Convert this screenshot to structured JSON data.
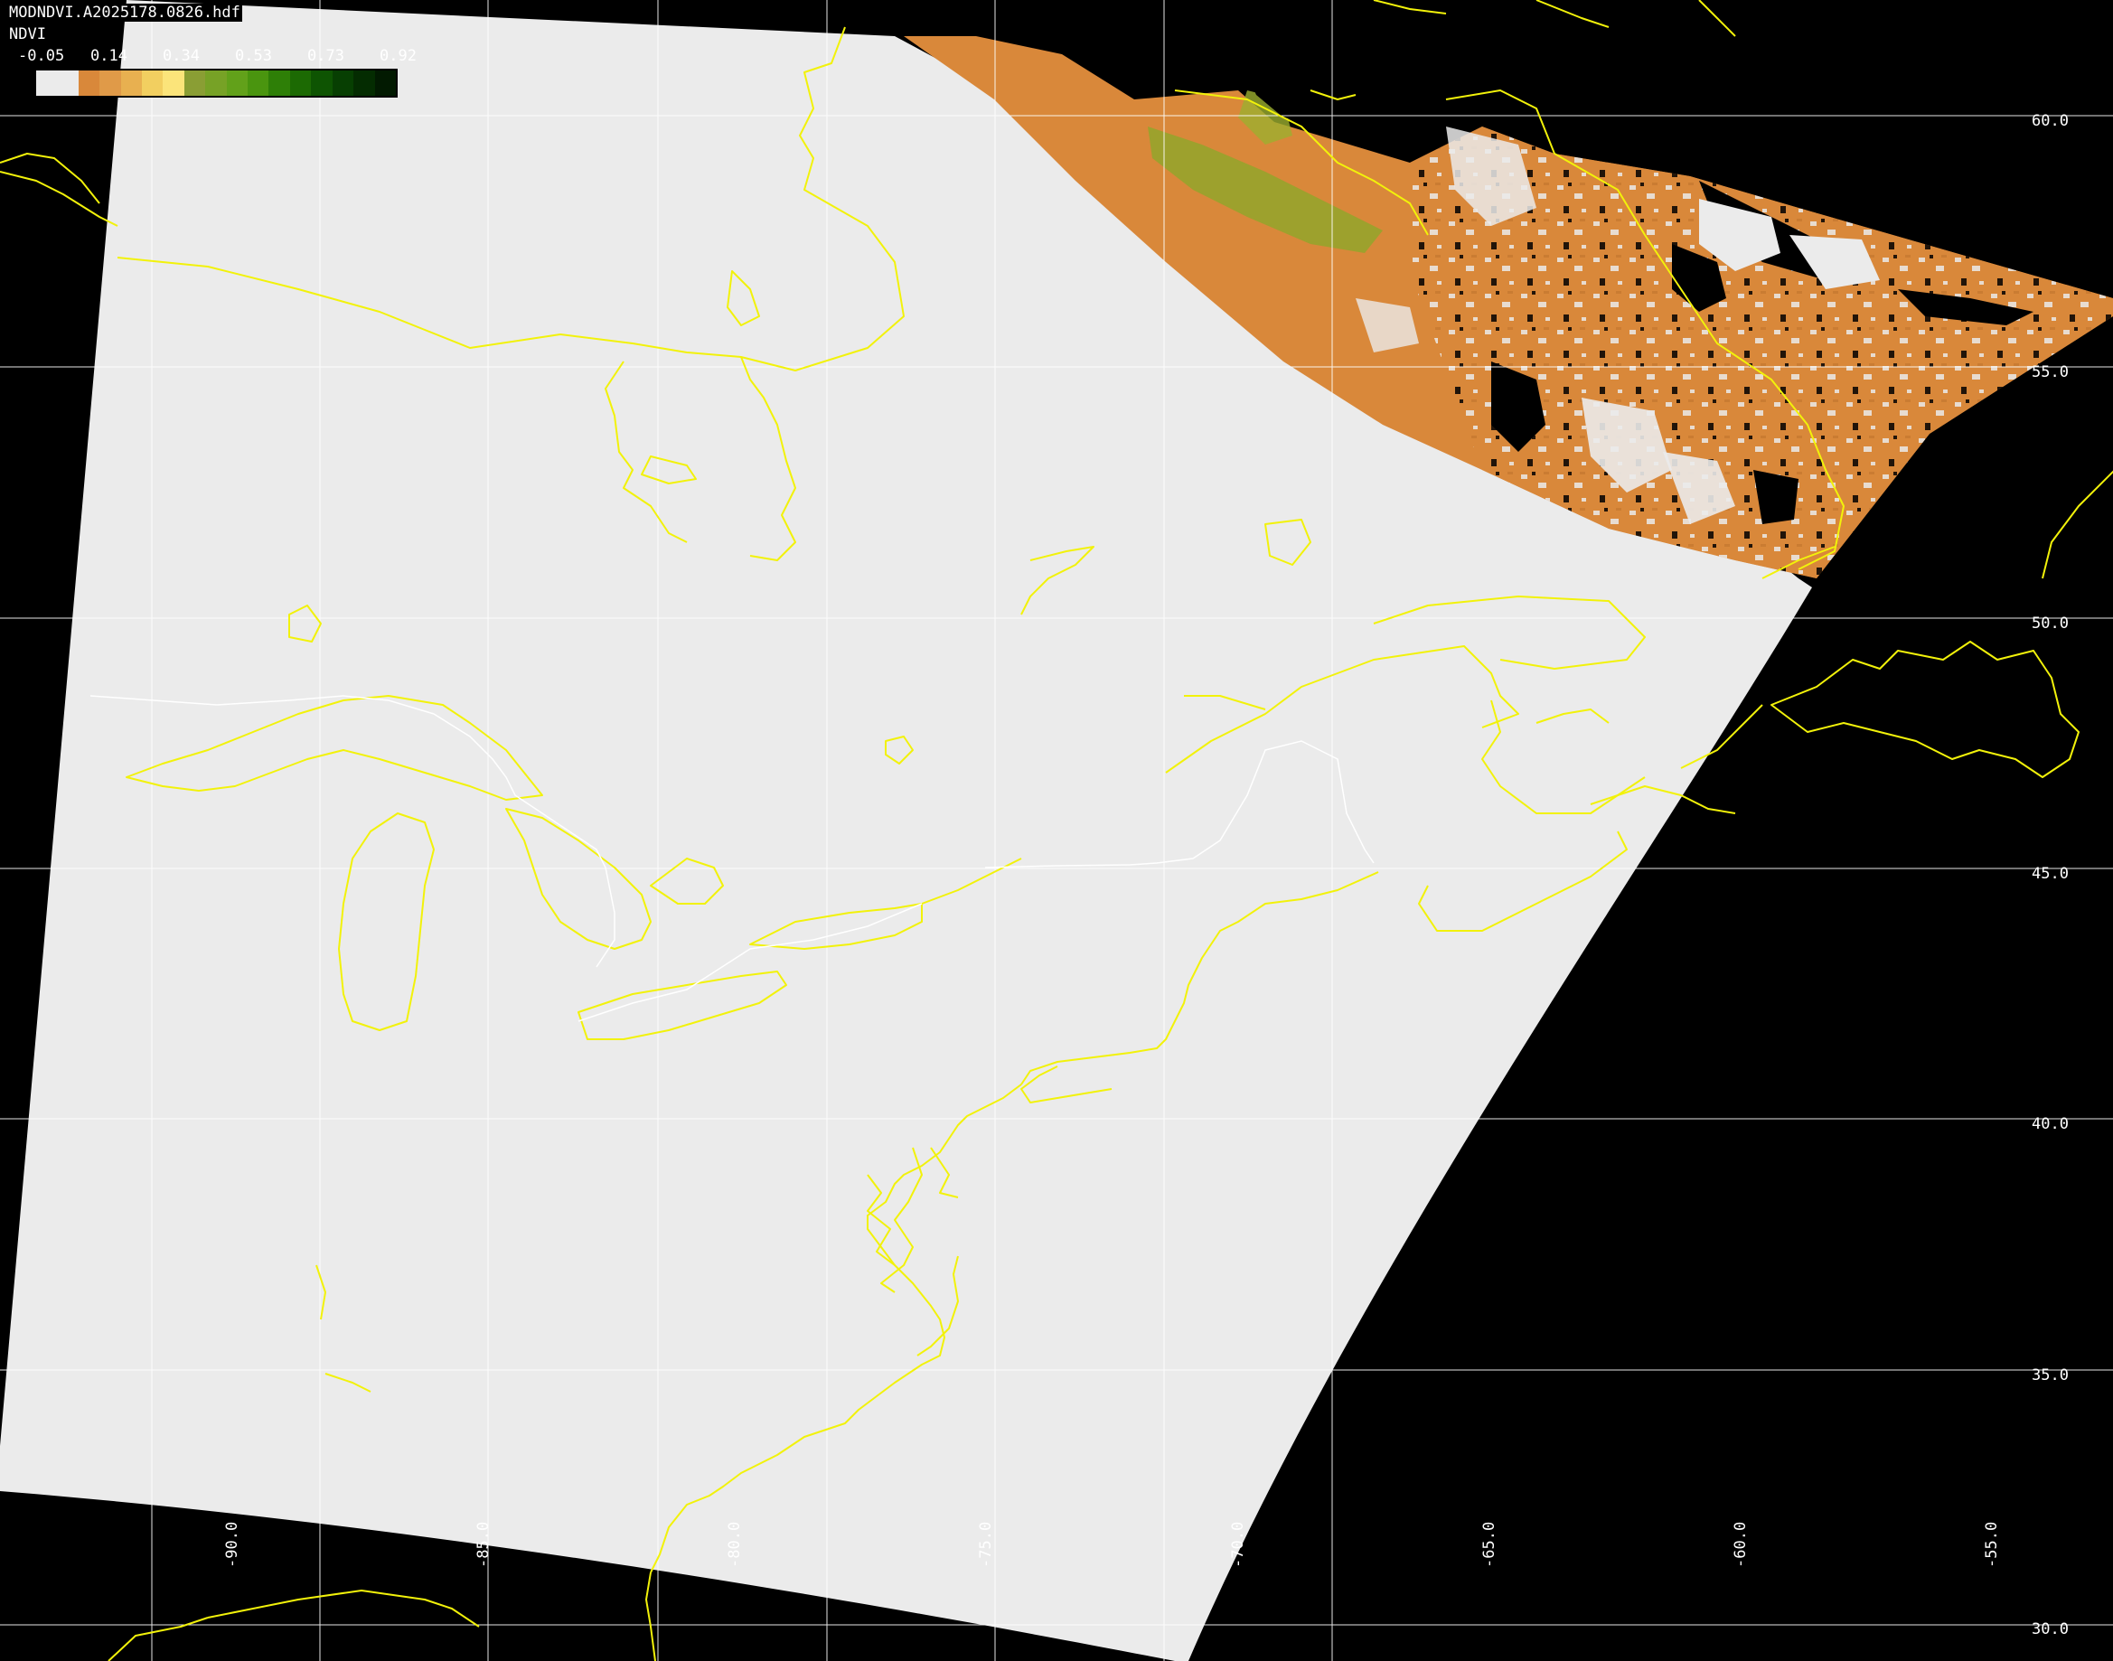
{
  "header": {
    "filename": "MODNDVI.A2025178.0826.hdf",
    "variable": "NDVI"
  },
  "colorbar": {
    "tick_labels": [
      "-0.05",
      "0.14",
      "0.34",
      "0.53",
      "0.73",
      "0.92"
    ],
    "segments": [
      "#ebebeb",
      "#d9883a",
      "#e09a48",
      "#e8b050",
      "#f2cf60",
      "#fbe47a",
      "#8a9e34",
      "#77a226",
      "#62a11a",
      "#4a950f",
      "#2e7f07",
      "#1c6a03",
      "#0e5402",
      "#073f02",
      "#042c01",
      "#021a01"
    ]
  },
  "map": {
    "colors": {
      "background": "#000000",
      "nodata_swath": "#ebebeb",
      "coastline": "#f2f20a",
      "border": "#ffffff",
      "grid": "#ffffff",
      "ndvi_low": "#d9883a",
      "ndvi_mid": "#e0943f",
      "ndvi_green": "#8da82a"
    },
    "longitude_labels": [
      "-90.0",
      "-85.0",
      "-80.0",
      "-75.0",
      "-70.0",
      "-65.0",
      "-60.0",
      "-55.0"
    ],
    "latitude_labels": [
      "60.0",
      "55.0",
      "50.0",
      "45.0",
      "40.0",
      "35.0",
      "30.0"
    ]
  }
}
